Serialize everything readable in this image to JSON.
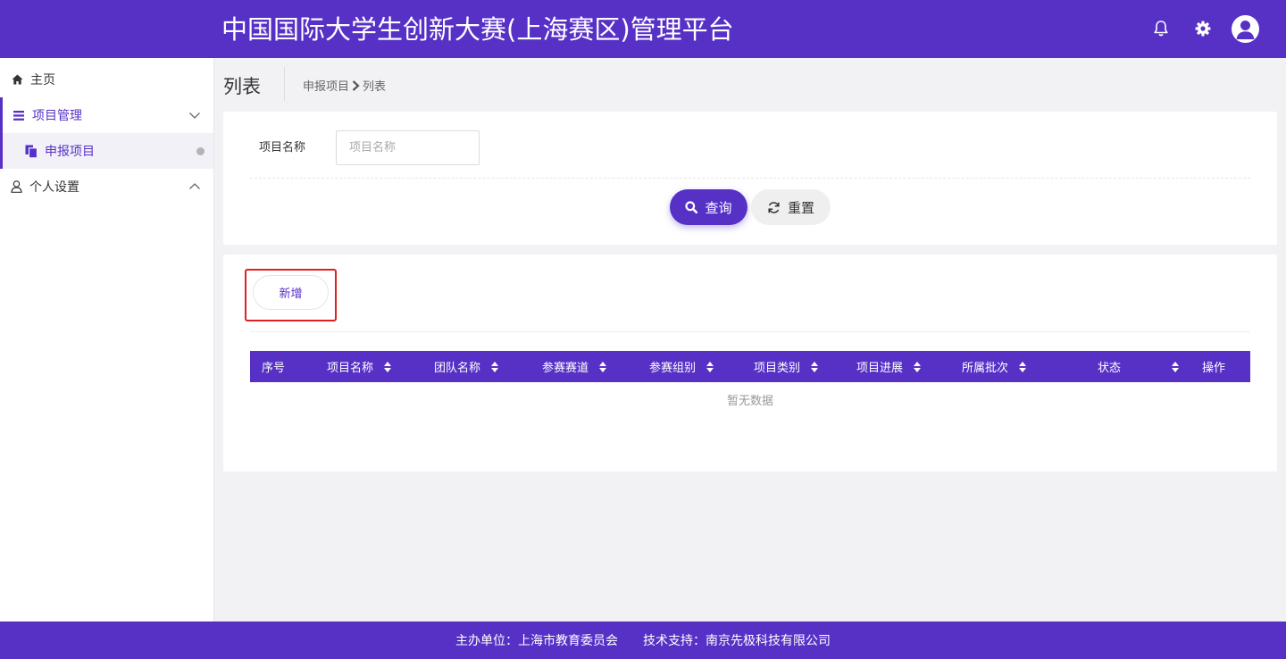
{
  "header": {
    "title": "中国国际大学生创新大赛(上海赛区)管理平台",
    "icons": [
      "bell-icon",
      "gear-icon",
      "user-avatar-icon"
    ]
  },
  "sidebar": {
    "items": [
      {
        "label": "主页",
        "icon": "home-icon"
      },
      {
        "label": "项目管理",
        "icon": "list-icon",
        "expanded": true
      },
      {
        "label": "申报项目",
        "icon": "copy-icon",
        "active": true
      },
      {
        "label": "个人设置",
        "icon": "user-icon",
        "expanded": false
      }
    ]
  },
  "page": {
    "title": "列表",
    "breadcrumb": [
      "申报项目",
      "列表"
    ]
  },
  "search": {
    "label": "项目名称",
    "placeholder": "项目名称",
    "value": "",
    "query_label": "查询",
    "reset_label": "重置"
  },
  "list": {
    "add_label": "新增",
    "columns": [
      "序号",
      "项目名称",
      "团队名称",
      "参赛赛道",
      "参赛组别",
      "项目类别",
      "项目进展",
      "所属批次",
      "状态",
      "操作"
    ],
    "rows": [],
    "empty_text": "暂无数据"
  },
  "footer": {
    "organizer": "主办单位：上海市教育委员会",
    "support": "技术支持：南京先极科技有限公司"
  },
  "colors": {
    "brand": "#5731c6",
    "highlight": "#e02020"
  }
}
